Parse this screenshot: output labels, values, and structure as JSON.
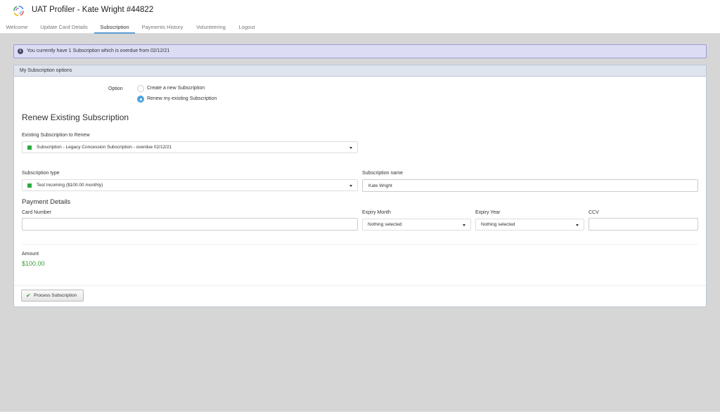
{
  "header": {
    "title": "UAT Profiler - Kate Wright #44822",
    "logo_icon": "swirl-logo-icon"
  },
  "tabs": [
    {
      "label": "Welcome"
    },
    {
      "label": "Update Card Details"
    },
    {
      "label": "Subscription"
    },
    {
      "label": "Payments History"
    },
    {
      "label": "Volunteering"
    },
    {
      "label": "Logout"
    }
  ],
  "active_tab": "Subscription",
  "alert": {
    "text": "You currently have 1 Subscription which is overdue from 02/12/21",
    "icon": "info-icon"
  },
  "panel": {
    "title": "My Subscription options",
    "option_label": "Option",
    "options": [
      {
        "label": "Create a new Subscription",
        "selected": false
      },
      {
        "label": "Renew my existing Subscription",
        "selected": true
      }
    ],
    "section_title": "Renew Existing Subscription",
    "existing": {
      "label": "Existing Subscription to Renew",
      "value": "Subscription - Legacy Concession Subscription - overdue 02/12/21"
    },
    "sub_type": {
      "label": "Subscription type",
      "value": "Test Incoming ($100.00 monthly)"
    },
    "sub_name": {
      "label": "Subscription name",
      "value": "Kate Wright"
    },
    "payment": {
      "title": "Payment Details",
      "card_label": "Card Number",
      "card_value": "",
      "expiry_month_label": "Expiry Month",
      "expiry_month_value": "Nothing selected",
      "expiry_year_label": "Expiry Year",
      "expiry_year_value": "Nothing selected",
      "ccv_label": "CCV",
      "ccv_value": ""
    },
    "amount": {
      "label": "Amount",
      "value": "$100.00"
    },
    "process_button": "Process Subscription"
  },
  "colors": {
    "accent": "#5b9bd5",
    "success": "#2eaa3f",
    "alert_bg": "#dcdcf5",
    "radio": "#4aa3df"
  }
}
